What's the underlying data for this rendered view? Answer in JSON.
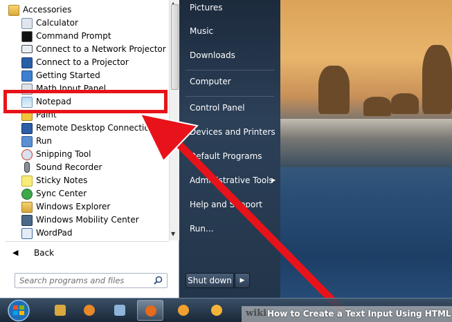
{
  "start_menu": {
    "programs": {
      "folder": "Accessories",
      "items": [
        "Calculator",
        "Command Prompt",
        "Connect to a Network Projector",
        "Connect to a Projector",
        "Getting Started",
        "Math Input Panel",
        "Notepad",
        "Paint",
        "Remote Desktop Connection",
        "Run",
        "Snipping Tool",
        "Sound Recorder",
        "Sticky Notes",
        "Sync Center",
        "Windows Explorer",
        "Windows Mobility Center",
        "WordPad"
      ],
      "highlighted_item": "Notepad"
    },
    "back_label": "Back",
    "search_placeholder": "Search programs and files",
    "right_pane": {
      "pictures": "Pictures",
      "music": "Music",
      "downloads": "Downloads",
      "computer": "Computer",
      "control_panel": "Control Panel",
      "devices_printers": "Devices and Printers",
      "default_programs": "Default Programs",
      "admin_tools": "Administrative Tools",
      "help_support": "Help and Support",
      "run": "Run..."
    },
    "shutdown_label": "Shut down"
  },
  "watermark": {
    "brand": "wiki",
    "caption": "How to Create a Text Input Using HTML"
  },
  "colors": {
    "highlight": "#e8131a",
    "menu_text": "#ffffff"
  }
}
